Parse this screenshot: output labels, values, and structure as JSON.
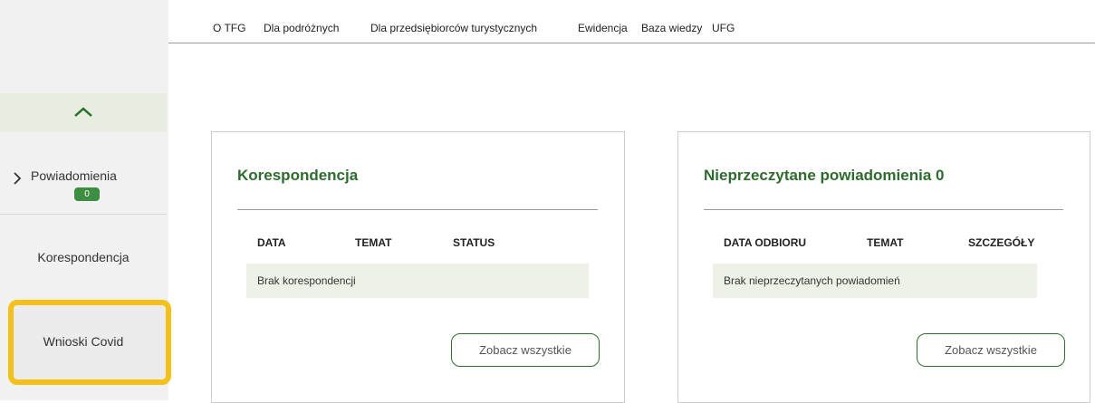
{
  "topnav": {
    "items": [
      "O TFG",
      "Dla podróżnych",
      "Dla przedsiębiorców turystycznych",
      "Ewidencja",
      "Baza wiedzy",
      "UFG"
    ]
  },
  "sidebar": {
    "notifications_label": "Powiadomienia",
    "notifications_count": "0",
    "correspondence_label": "Korespondencja",
    "covid_label": "Wnioski Covid"
  },
  "correspondence_card": {
    "title": "Korespondencja",
    "columns": [
      "DATA",
      "TEMAT",
      "STATUS"
    ],
    "empty_text": "Brak korespondencji",
    "button_label": "Zobacz wszystkie"
  },
  "notifications_card": {
    "title": "Nieprzeczytane powiadomienia 0",
    "columns": [
      "DATA ODBIORU",
      "TEMAT",
      "SZCZEGÓŁY"
    ],
    "empty_text": "Brak nieprzeczytanych powiadomień",
    "button_label": "Zobacz wszystkie"
  },
  "colors": {
    "accent_green": "#2e6b2e",
    "badge_green": "#3e8e41",
    "highlight_yellow": "#f3c11a"
  },
  "icons": [
    "chevron-up-icon",
    "chevron-right-icon"
  ]
}
